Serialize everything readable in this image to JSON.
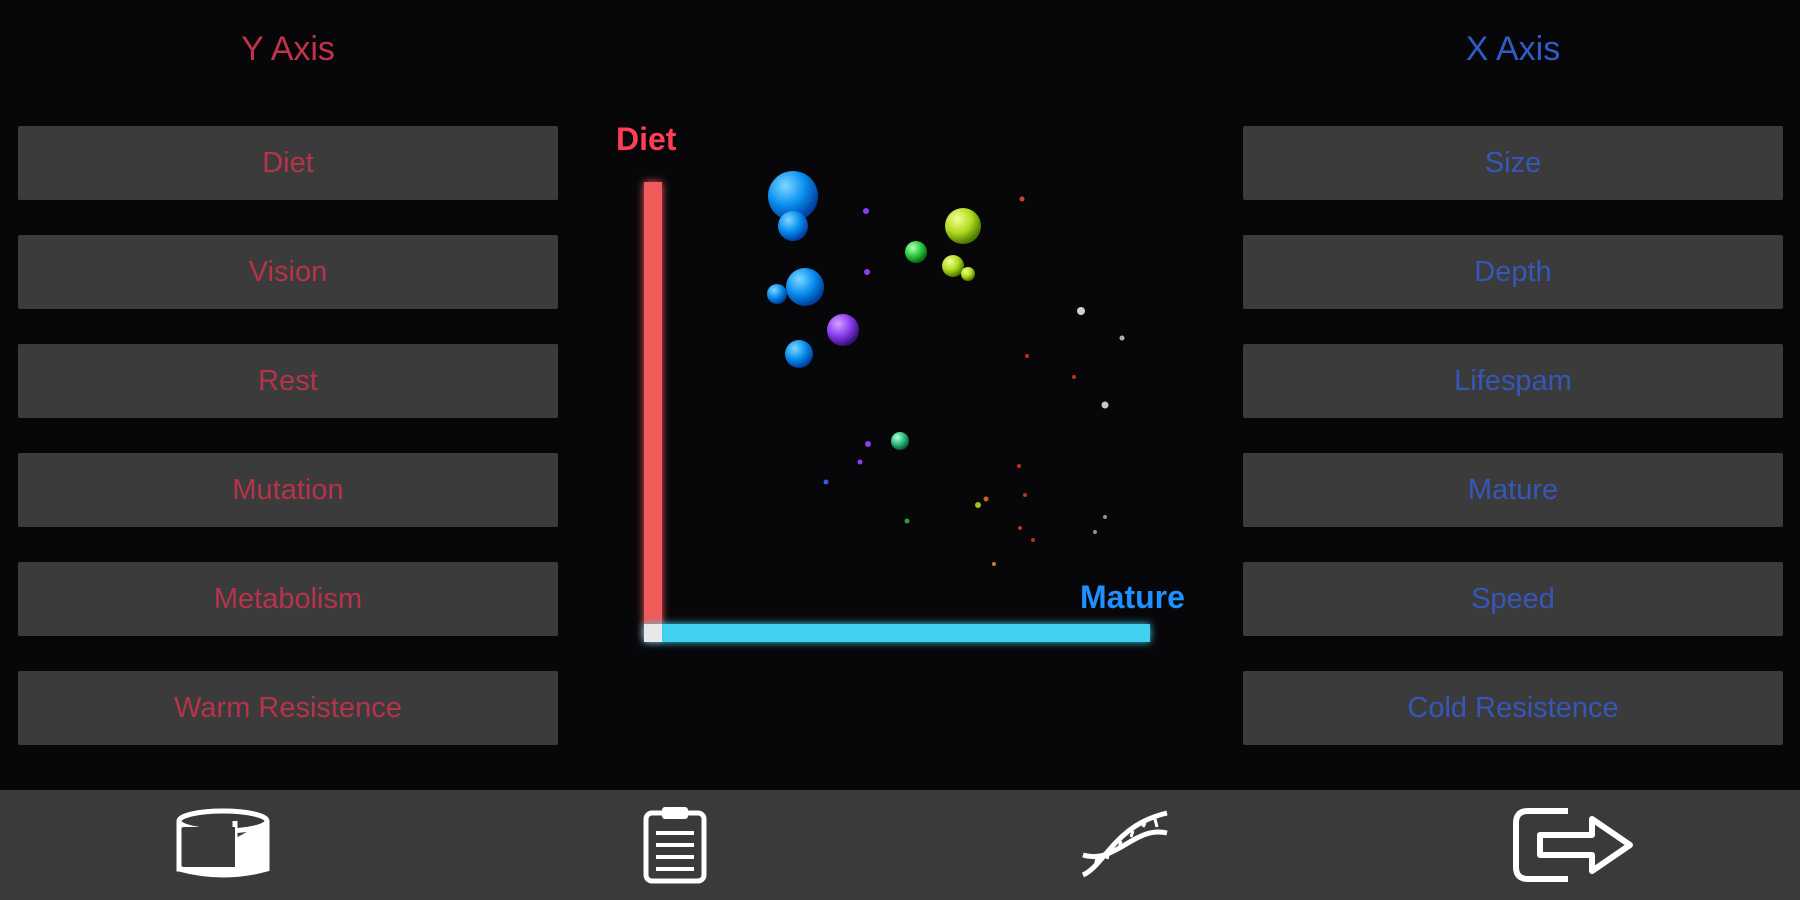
{
  "y_axis": {
    "title": "Y Axis",
    "color": "#c0334a",
    "options": [
      "Diet",
      "Vision",
      "Rest",
      "Mutation",
      "Metabolism",
      "Warm Resistence"
    ]
  },
  "x_axis": {
    "title": "X Axis",
    "color": "#2f5dc8",
    "options": [
      "Size",
      "Depth",
      "Lifespam",
      "Mature",
      "Speed",
      "Cold Resistence"
    ]
  },
  "plot": {
    "y_label": "Diet",
    "x_label": "Mature",
    "y_color": "#ff3d55",
    "x_color": "#1e90ff",
    "y_bar_color": "#f05a5a",
    "x_bar_color": "#3fd0f0"
  },
  "bottom_nav": [
    {
      "name": "database-icon"
    },
    {
      "name": "clipboard-icon"
    },
    {
      "name": "dna-icon"
    },
    {
      "name": "exit-icon"
    }
  ]
}
